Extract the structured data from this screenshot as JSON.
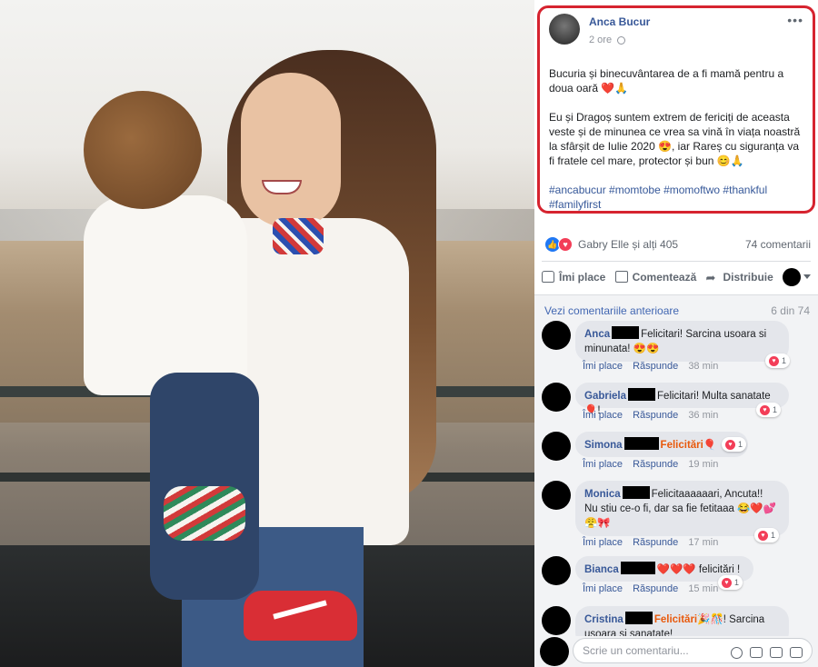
{
  "post": {
    "author": "Anca Bucur",
    "time": "2 ore",
    "paragraph1": "Bucuria și binecuvântarea de a fi mamă pentru a doua oară ❤️🙏",
    "paragraph2": "Eu și Dragoș suntem extrem de fericiți de aceasta veste și de minunea ce vrea sa vină în viața noastră la sfârșit de Iulie 2020 😍, iar Rareș cu siguranța va fi fratele cel mare, protector și bun 😊🙏",
    "hashtags": "#ancabucur #momtobe #momoftwo #thankful #familyfirst",
    "highlight_color": "#d6232f"
  },
  "reactions": {
    "summary": "Gabry Elle și alți 405",
    "comments_count": "74 comentarii"
  },
  "actions": {
    "like": "Îmi place",
    "comment": "Comentează",
    "share": "Distribuie"
  },
  "comments_header": {
    "view_previous": "Vezi comentariile anterioare",
    "page_count": "6 din 74"
  },
  "comments": [
    {
      "name": "Anca",
      "text": "Felicitari! Sarcina usoara si",
      "text2": "minunata! 😍😍",
      "reacts": "1",
      "like": "Îmi place",
      "reply": "Răspunde",
      "time": "38 min"
    },
    {
      "name": "Gabriela",
      "text": "Felicitari! Multa sanatate 🎈!",
      "reacts": "1",
      "like": "Îmi place",
      "reply": "Răspunde",
      "time": "36 min"
    },
    {
      "name": "Simona",
      "text": "Felicitări",
      "text_suffix": "🎈",
      "reacts": "1",
      "like": "Îmi place",
      "reply": "Răspunde",
      "time": "19 min"
    },
    {
      "name": "Monica",
      "text": "Felicitaaaaaari, Ancuta!!",
      "text2": "Nu stiu ce-o fi, dar sa fie fetitaaa 😂❤️💕",
      "text3": "😤🎀",
      "reacts": "1",
      "like": "Îmi place",
      "reply": "Răspunde",
      "time": "17 min"
    },
    {
      "name": "Bianca",
      "text": "❤️❤️❤️ felicitări !",
      "reacts": "1",
      "like": "Îmi place",
      "reply": "Răspunde",
      "time": "15 min"
    },
    {
      "name": "Cristina",
      "text": "Felicitări",
      "text_suffix": "🎉🎊! Sarcina",
      "text2": "usoara si sanatate!"
    }
  ],
  "composer": {
    "placeholder": "Scrie un comentariu..."
  }
}
